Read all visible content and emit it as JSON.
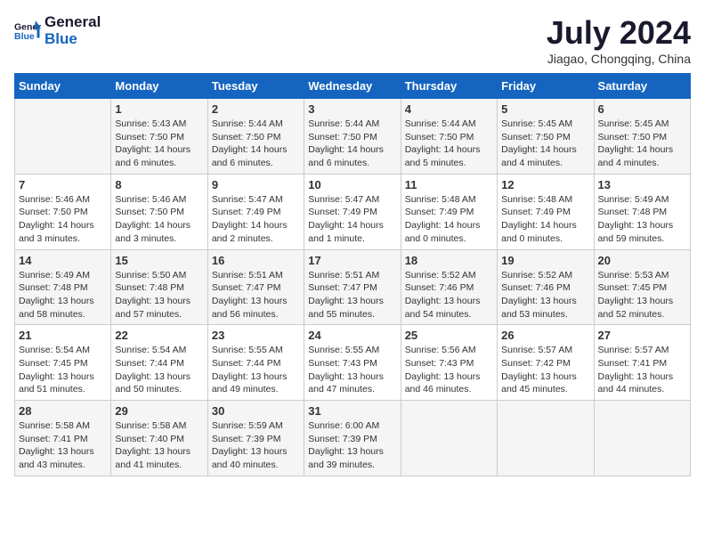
{
  "header": {
    "logo_line1": "General",
    "logo_line2": "Blue",
    "month_title": "July 2024",
    "location": "Jiagao, Chongqing, China"
  },
  "weekdays": [
    "Sunday",
    "Monday",
    "Tuesday",
    "Wednesday",
    "Thursday",
    "Friday",
    "Saturday"
  ],
  "weeks": [
    [
      {
        "day": "",
        "info": ""
      },
      {
        "day": "1",
        "info": "Sunrise: 5:43 AM\nSunset: 7:50 PM\nDaylight: 14 hours\nand 6 minutes."
      },
      {
        "day": "2",
        "info": "Sunrise: 5:44 AM\nSunset: 7:50 PM\nDaylight: 14 hours\nand 6 minutes."
      },
      {
        "day": "3",
        "info": "Sunrise: 5:44 AM\nSunset: 7:50 PM\nDaylight: 14 hours\nand 6 minutes."
      },
      {
        "day": "4",
        "info": "Sunrise: 5:44 AM\nSunset: 7:50 PM\nDaylight: 14 hours\nand 5 minutes."
      },
      {
        "day": "5",
        "info": "Sunrise: 5:45 AM\nSunset: 7:50 PM\nDaylight: 14 hours\nand 4 minutes."
      },
      {
        "day": "6",
        "info": "Sunrise: 5:45 AM\nSunset: 7:50 PM\nDaylight: 14 hours\nand 4 minutes."
      }
    ],
    [
      {
        "day": "7",
        "info": "Sunrise: 5:46 AM\nSunset: 7:50 PM\nDaylight: 14 hours\nand 3 minutes."
      },
      {
        "day": "8",
        "info": "Sunrise: 5:46 AM\nSunset: 7:50 PM\nDaylight: 14 hours\nand 3 minutes."
      },
      {
        "day": "9",
        "info": "Sunrise: 5:47 AM\nSunset: 7:49 PM\nDaylight: 14 hours\nand 2 minutes."
      },
      {
        "day": "10",
        "info": "Sunrise: 5:47 AM\nSunset: 7:49 PM\nDaylight: 14 hours\nand 1 minute."
      },
      {
        "day": "11",
        "info": "Sunrise: 5:48 AM\nSunset: 7:49 PM\nDaylight: 14 hours\nand 0 minutes."
      },
      {
        "day": "12",
        "info": "Sunrise: 5:48 AM\nSunset: 7:49 PM\nDaylight: 14 hours\nand 0 minutes."
      },
      {
        "day": "13",
        "info": "Sunrise: 5:49 AM\nSunset: 7:48 PM\nDaylight: 13 hours\nand 59 minutes."
      }
    ],
    [
      {
        "day": "14",
        "info": "Sunrise: 5:49 AM\nSunset: 7:48 PM\nDaylight: 13 hours\nand 58 minutes."
      },
      {
        "day": "15",
        "info": "Sunrise: 5:50 AM\nSunset: 7:48 PM\nDaylight: 13 hours\nand 57 minutes."
      },
      {
        "day": "16",
        "info": "Sunrise: 5:51 AM\nSunset: 7:47 PM\nDaylight: 13 hours\nand 56 minutes."
      },
      {
        "day": "17",
        "info": "Sunrise: 5:51 AM\nSunset: 7:47 PM\nDaylight: 13 hours\nand 55 minutes."
      },
      {
        "day": "18",
        "info": "Sunrise: 5:52 AM\nSunset: 7:46 PM\nDaylight: 13 hours\nand 54 minutes."
      },
      {
        "day": "19",
        "info": "Sunrise: 5:52 AM\nSunset: 7:46 PM\nDaylight: 13 hours\nand 53 minutes."
      },
      {
        "day": "20",
        "info": "Sunrise: 5:53 AM\nSunset: 7:45 PM\nDaylight: 13 hours\nand 52 minutes."
      }
    ],
    [
      {
        "day": "21",
        "info": "Sunrise: 5:54 AM\nSunset: 7:45 PM\nDaylight: 13 hours\nand 51 minutes."
      },
      {
        "day": "22",
        "info": "Sunrise: 5:54 AM\nSunset: 7:44 PM\nDaylight: 13 hours\nand 50 minutes."
      },
      {
        "day": "23",
        "info": "Sunrise: 5:55 AM\nSunset: 7:44 PM\nDaylight: 13 hours\nand 49 minutes."
      },
      {
        "day": "24",
        "info": "Sunrise: 5:55 AM\nSunset: 7:43 PM\nDaylight: 13 hours\nand 47 minutes."
      },
      {
        "day": "25",
        "info": "Sunrise: 5:56 AM\nSunset: 7:43 PM\nDaylight: 13 hours\nand 46 minutes."
      },
      {
        "day": "26",
        "info": "Sunrise: 5:57 AM\nSunset: 7:42 PM\nDaylight: 13 hours\nand 45 minutes."
      },
      {
        "day": "27",
        "info": "Sunrise: 5:57 AM\nSunset: 7:41 PM\nDaylight: 13 hours\nand 44 minutes."
      }
    ],
    [
      {
        "day": "28",
        "info": "Sunrise: 5:58 AM\nSunset: 7:41 PM\nDaylight: 13 hours\nand 43 minutes."
      },
      {
        "day": "29",
        "info": "Sunrise: 5:58 AM\nSunset: 7:40 PM\nDaylight: 13 hours\nand 41 minutes."
      },
      {
        "day": "30",
        "info": "Sunrise: 5:59 AM\nSunset: 7:39 PM\nDaylight: 13 hours\nand 40 minutes."
      },
      {
        "day": "31",
        "info": "Sunrise: 6:00 AM\nSunset: 7:39 PM\nDaylight: 13 hours\nand 39 minutes."
      },
      {
        "day": "",
        "info": ""
      },
      {
        "day": "",
        "info": ""
      },
      {
        "day": "",
        "info": ""
      }
    ]
  ]
}
